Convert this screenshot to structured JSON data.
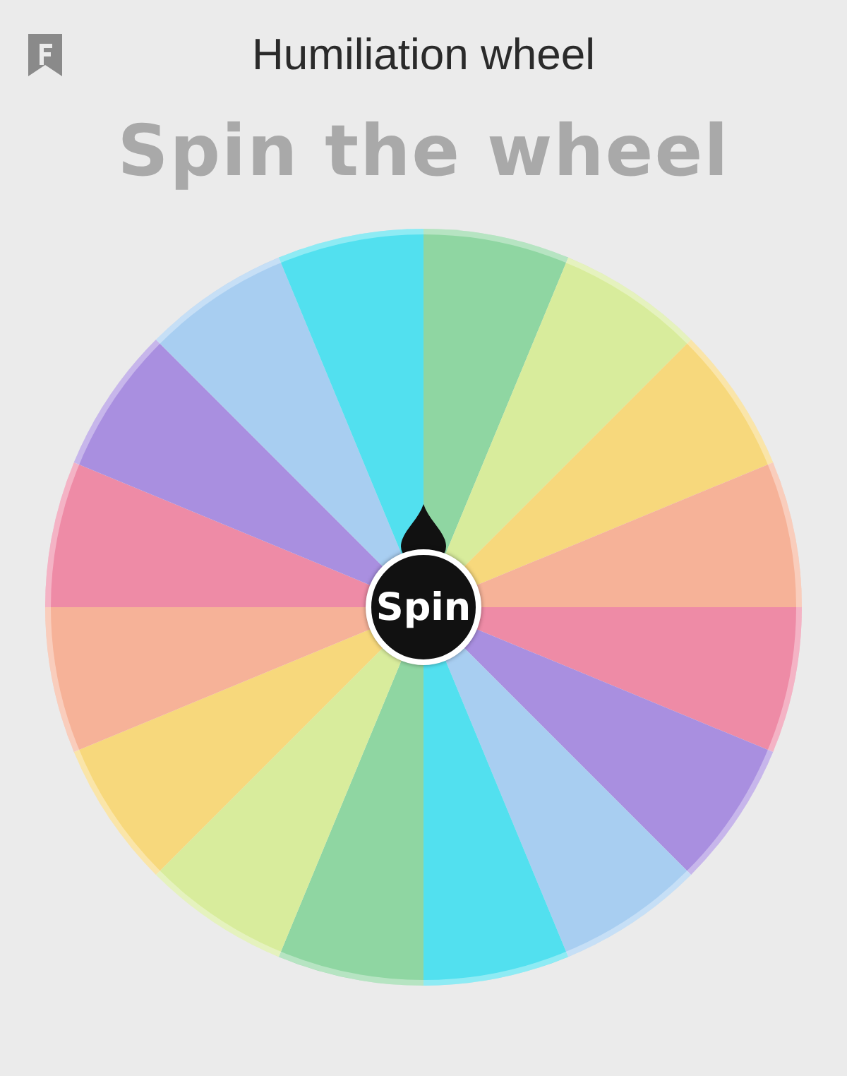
{
  "window": {
    "title": "Humiliation wheel"
  },
  "heading": "Spin the wheel",
  "wheel": {
    "segments": [
      {
        "color": "#8fd6a2"
      },
      {
        "color": "#d8ec9c"
      },
      {
        "color": "#f7d87c"
      },
      {
        "color": "#f6b298"
      },
      {
        "color": "#ee8ba6"
      },
      {
        "color": "#a98fe0"
      },
      {
        "color": "#a8cef1"
      },
      {
        "color": "#52e0ef"
      },
      {
        "color": "#8fd6a2"
      },
      {
        "color": "#d8ec9c"
      },
      {
        "color": "#f7d87c"
      },
      {
        "color": "#f6b298"
      },
      {
        "color": "#ee8ba6"
      },
      {
        "color": "#a98fe0"
      },
      {
        "color": "#a8cef1"
      },
      {
        "color": "#52e0ef"
      }
    ],
    "spin_button": "Spin"
  }
}
